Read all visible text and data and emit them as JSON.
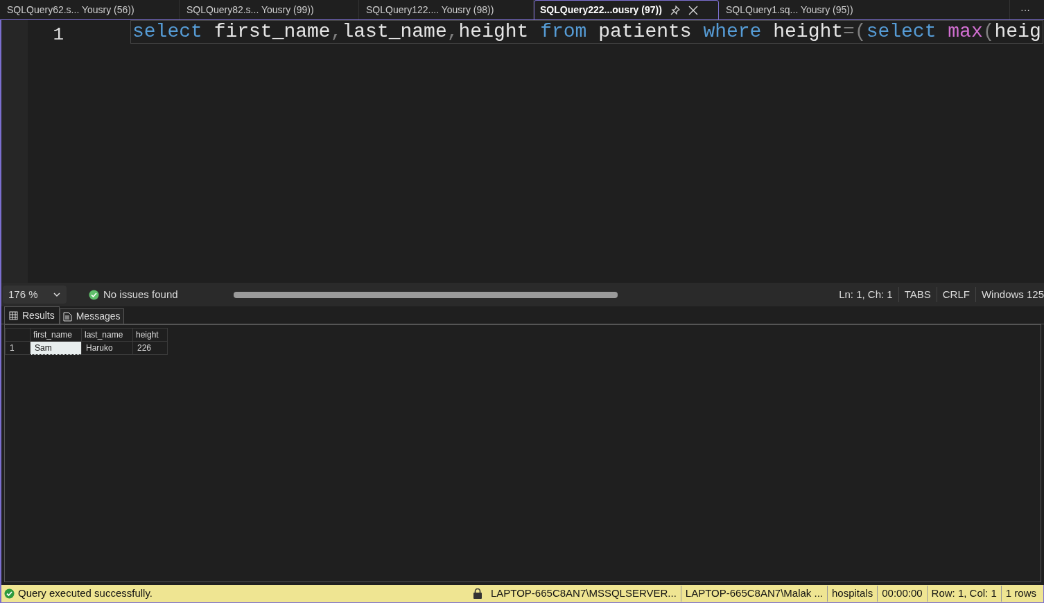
{
  "tabs": [
    {
      "label": "SQLQuery62.s... Yousry (56))",
      "selected": false
    },
    {
      "label": "SQLQuery82.s... Yousry (99))",
      "selected": false
    },
    {
      "label": "SQLQuery122.... Yousry (98))",
      "selected": false
    },
    {
      "label": "SQLQuery222...ousry (97))",
      "selected": true
    },
    {
      "label": "SQLQuery1.sq... Yousry (95))",
      "selected": false
    }
  ],
  "tab_overflow": "···",
  "editor": {
    "line_number": "1",
    "tokens": [
      {
        "text": "select",
        "kind": "keyword"
      },
      {
        "text": " first_name",
        "kind": "ident"
      },
      {
        "text": ",",
        "kind": "punct"
      },
      {
        "text": "last_name",
        "kind": "ident"
      },
      {
        "text": ",",
        "kind": "punct"
      },
      {
        "text": "height ",
        "kind": "ident"
      },
      {
        "text": "from",
        "kind": "keyword"
      },
      {
        "text": " patients ",
        "kind": "ident"
      },
      {
        "text": "where",
        "kind": "keyword"
      },
      {
        "text": " height",
        "kind": "ident"
      },
      {
        "text": "=(",
        "kind": "punct"
      },
      {
        "text": "select ",
        "kind": "keyword"
      },
      {
        "text": "max",
        "kind": "func"
      },
      {
        "text": "(",
        "kind": "punct"
      },
      {
        "text": "heig",
        "kind": "ident"
      }
    ]
  },
  "editor_status": {
    "zoom": "176 %",
    "issues": "No issues found",
    "position": "Ln: 1, Ch: 1",
    "indent": "TABS",
    "line_ending": "CRLF",
    "encoding": "Windows 125"
  },
  "result_tabs": [
    {
      "label": "Results",
      "selected": true
    },
    {
      "label": "Messages",
      "selected": false
    }
  ],
  "grid": {
    "columns": [
      "first_name",
      "last_name",
      "height"
    ],
    "rows": [
      {
        "number": "1",
        "cells": [
          "Sam",
          "Haruko",
          "226"
        ]
      }
    ]
  },
  "status_bar": {
    "message": "Query executed successfully.",
    "items": [
      "LAPTOP-665C8AN7\\MSSQLSERVER...",
      "LAPTOP-665C8AN7\\Malak ...",
      "hospitals",
      "00:00:00",
      "Row: 1, Col: 1",
      "1 rows"
    ]
  }
}
